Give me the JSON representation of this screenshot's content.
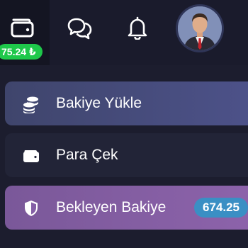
{
  "header": {
    "wallet_balance": "75.24 ₺"
  },
  "icons": {
    "wallet": "wallet-icon",
    "chat": "chat-bubbles-icon",
    "notifications": "bell-icon",
    "avatar": "user-avatar"
  },
  "menu": {
    "items": [
      {
        "label": "Bakiye Yükle",
        "icon": "coins-stack-icon"
      },
      {
        "label": "Para Çek",
        "icon": "wallet-icon"
      },
      {
        "label": "Bekleyen Bakiye",
        "icon": "shield-icon",
        "amount": "674.25"
      }
    ]
  },
  "colors": {
    "background": "#1c1d2e",
    "balance_badge": "#1ec84a",
    "deposit_item": "#4a4f82",
    "pending_item": "#8560a6",
    "amount_badge": "#3a8fc4"
  }
}
